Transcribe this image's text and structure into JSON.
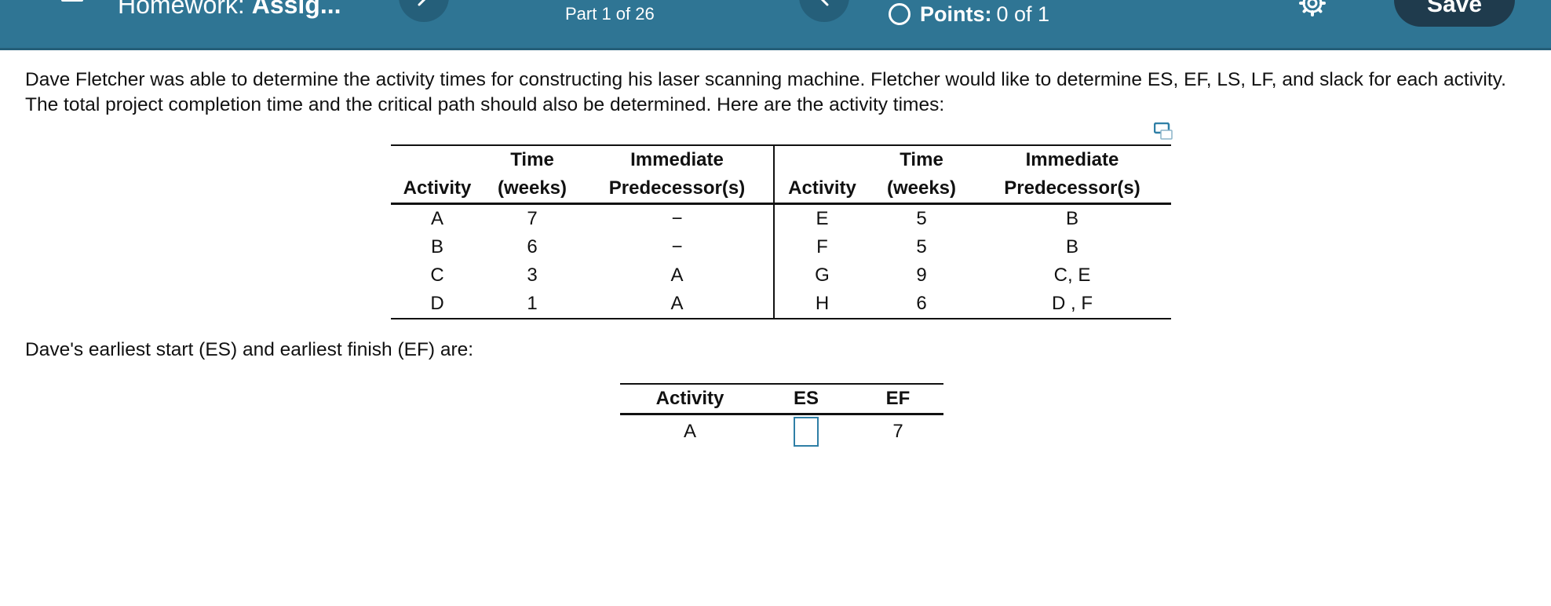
{
  "header": {
    "title_light": "Homework:",
    "title_bold": "Assig...",
    "part_label": "Part 1 of 26",
    "points_label": "Points:",
    "points_value": "0 of 1",
    "save_label": "Save"
  },
  "question": {
    "text": "Dave Fletcher was able to determine the activity times for constructing his laser scanning machine. Fletcher would like to determine ES, EF, LS, LF, and slack for each activity. The total project completion time and the critical path should also be determined. Here are the activity times:"
  },
  "activity_table": {
    "headers": {
      "activity": "Activity",
      "time_top": "Time",
      "time_bottom": "(weeks)",
      "pred_top": "Immediate",
      "pred_bottom": "Predecessor(s)"
    },
    "rows": [
      {
        "a1": "A",
        "t1": "7",
        "p1": "−",
        "a2": "E",
        "t2": "5",
        "p2": "B"
      },
      {
        "a1": "B",
        "t1": "6",
        "p1": "−",
        "a2": "F",
        "t2": "5",
        "p2": "B"
      },
      {
        "a1": "C",
        "t1": "3",
        "p1": "A",
        "a2": "G",
        "t2": "9",
        "p2": "C, E"
      },
      {
        "a1": "D",
        "t1": "1",
        "p1": "A",
        "a2": "H",
        "t2": "6",
        "p2": "D , F"
      }
    ]
  },
  "es_prompt": "Dave's earliest start (ES) and earliest finish (EF) are:",
  "es_table": {
    "headers": {
      "activity": "Activity",
      "es": "ES",
      "ef": "EF"
    },
    "rows": [
      {
        "activity": "A",
        "es": "",
        "ef": "7"
      }
    ]
  },
  "colors": {
    "header_bg": "#2f7594",
    "save_bg": "#1f3b4d",
    "input_border": "#2f7fa6"
  },
  "icons": [
    "menu-icon",
    "chevron-left-icon",
    "chevron-right-icon",
    "radio-circle-icon",
    "settings-gear-icon",
    "expand-icon"
  ]
}
